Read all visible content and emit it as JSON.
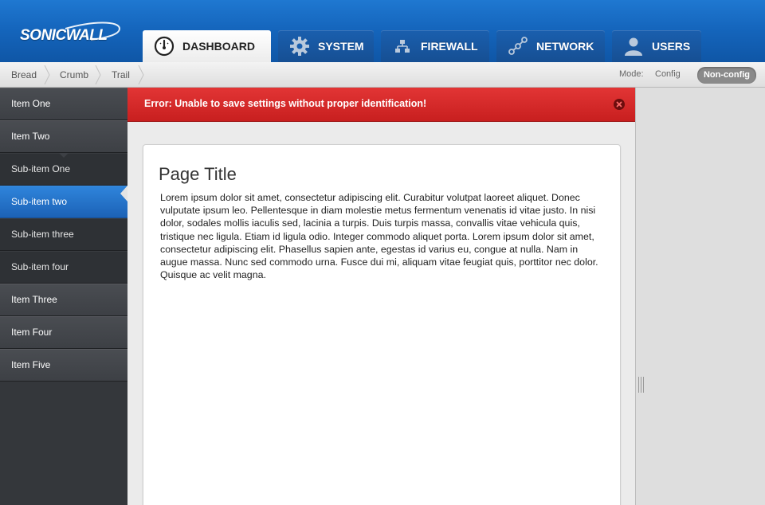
{
  "brand": {
    "name": "SONICWALL"
  },
  "tabs": [
    {
      "label": "DASHBOARD",
      "icon": "gauge-icon",
      "active": true
    },
    {
      "label": "SYSTEM",
      "icon": "gear-icon",
      "active": false
    },
    {
      "label": "FIREWALL",
      "icon": "firewall-network-icon",
      "active": false
    },
    {
      "label": "NETWORK",
      "icon": "network-nodes-icon",
      "active": false
    },
    {
      "label": "USERS",
      "icon": "user-icon",
      "active": false
    }
  ],
  "breadcrumb": [
    "Bread",
    "Crumb",
    "Trail"
  ],
  "mode": {
    "label": "Mode:",
    "option": "Config",
    "current": "Non-config"
  },
  "sidebar": {
    "items": [
      {
        "label": "Item One",
        "level": "top"
      },
      {
        "label": "Item Two",
        "level": "top"
      },
      {
        "label": "Sub-item One",
        "level": "sub"
      },
      {
        "label": "Sub-item two",
        "level": "sub",
        "active": true
      },
      {
        "label": "Sub-item three",
        "level": "sub"
      },
      {
        "label": "Sub-item four",
        "level": "sub"
      },
      {
        "label": "Item Three",
        "level": "top"
      },
      {
        "label": "Item Four",
        "level": "top"
      },
      {
        "label": "Item Five",
        "level": "top"
      }
    ]
  },
  "error": {
    "message": "Error: Unable to save settings without proper identification!"
  },
  "content": {
    "title": "Page Title",
    "body": "Lorem ipsum dolor sit amet, consectetur adipiscing elit. Curabitur volutpat laoreet aliquet. Donec vulputate ipsum leo. Pellentesque in diam molestie metus fermentum venenatis id vitae justo. In nisi dolor, sodales mollis iaculis sed, lacinia a turpis. Duis turpis massa, convallis vitae vehicula quis, tristique nec ligula. Etiam id ligula odio. Integer commodo aliquet porta. Lorem ipsum dolor sit amet, consectetur adipiscing elit. Phasellus sapien ante, egestas id varius eu, congue at nulla. Nam in augue massa. Nunc sed commodo urna. Fusce dui mi, aliquam vitae feugiat quis, porttitor nec dolor. Quisque ac velit magna."
  },
  "colors": {
    "header_blue": "#1566bd",
    "error_red": "#d42a2a",
    "active_blue": "#2a7ad2",
    "sidebar_dark": "#34373b"
  }
}
